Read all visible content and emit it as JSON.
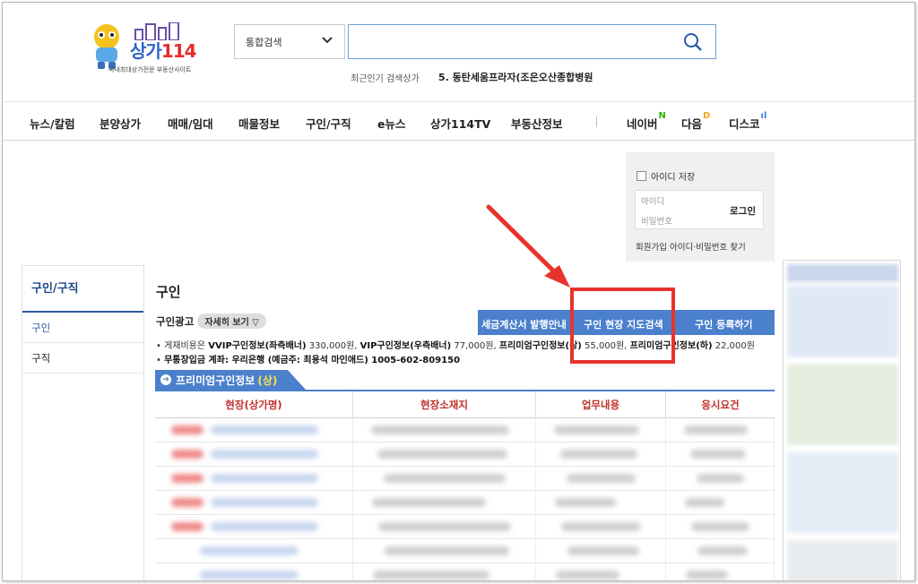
{
  "logo": {
    "brand": "상가",
    "number": "114",
    "tagline": "국내최대상가전문 부동산사이트"
  },
  "search": {
    "scope": "통합검색",
    "value": ""
  },
  "popular": {
    "label": "최근인기 검색상가",
    "item": "5. 동탄세움프라자(조은오산종합병원"
  },
  "nav": {
    "items": [
      "뉴스/칼럼",
      "분양상가",
      "매매/임대",
      "매물정보",
      "구인/구직",
      "e뉴스",
      "상가114TV",
      "부동산정보"
    ],
    "portals": [
      {
        "label": "네이버",
        "mark": "N",
        "color": "#2db400"
      },
      {
        "label": "다음",
        "mark": "D",
        "color": "#f5a623"
      },
      {
        "label": "디스코",
        "mark": "ıl",
        "color": "#3b7ddd"
      }
    ]
  },
  "login": {
    "remember": "아이디 저장",
    "id_placeholder": "아이디",
    "pw_placeholder": "비밀번호",
    "button": "로그인",
    "links": "회원가입 아이디·비밀번호 찾기"
  },
  "sidebar": {
    "title": "구인/구직",
    "items": [
      "구인",
      "구직"
    ]
  },
  "main": {
    "title": "구인",
    "ad_title": "구인광고",
    "detail_button": "자세히 보기 ▽",
    "bar": [
      "세금계산서 발행안내",
      "구인 현장 지도검색",
      "구인 등록하기"
    ],
    "fees_prefix": "게재비용은 ",
    "fees": [
      {
        "name": "VVIP구인정보(좌측배너)",
        "price": " 330,000원, "
      },
      {
        "name": "VIP구인정보(우측배너)",
        "price": " 77,000원, "
      },
      {
        "name": "프리미엄구인정보(상)",
        "price": " 55,000원, "
      },
      {
        "name": "프리미엄구인정보(하)",
        "price": " 22,000원"
      }
    ],
    "account": "무통장입금 계좌: 우리은행 (예금주: 최용석 마인애드) 1005-602-809150",
    "premium_tab": "프리미엄구인정보",
    "premium_tag": "(상)",
    "columns": [
      "현장(상가명)",
      "현장소재지",
      "업무내용",
      "응시요건"
    ]
  },
  "colors": {
    "accent": "#4a80cc",
    "annotation": "#e8332c",
    "header_text": "#c0302a"
  }
}
